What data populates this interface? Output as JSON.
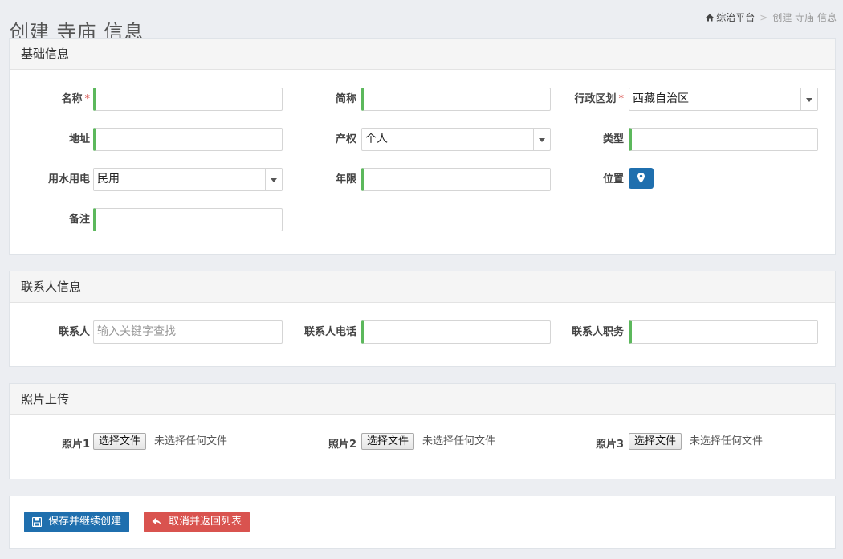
{
  "page": {
    "title": "创建 寺庙 信息"
  },
  "breadcrumb": {
    "home": "综治平台",
    "separator": ">",
    "current": "创建 寺庙 信息"
  },
  "basic": {
    "heading": "基础信息",
    "name_label": "名称",
    "short_name_label": "简称",
    "region_label": "行政区划",
    "region_value": "西藏自治区",
    "address_label": "地址",
    "property_label": "产权",
    "property_value": "个人",
    "type_label": "类型",
    "utility_label": "用水用电",
    "utility_value": "民用",
    "years_label": "年限",
    "location_label": "位置",
    "remark_label": "备注",
    "required_mark": "*"
  },
  "contact": {
    "heading": "联系人信息",
    "person_label": "联系人",
    "person_placeholder": "输入关键字查找",
    "phone_label": "联系人电话",
    "position_label": "联系人职务"
  },
  "photos": {
    "heading": "照片上传",
    "photo1_label": "照片1",
    "photo2_label": "照片2",
    "photo3_label": "照片3",
    "choose_button": "选择文件",
    "no_file_text": "未选择任何文件"
  },
  "actions": {
    "save_label": "保存并继续创建",
    "cancel_label": "取消并返回列表"
  },
  "colors": {
    "primary": "#1f6fae",
    "danger": "#d9534f",
    "valid_accent": "#5cb85c"
  }
}
